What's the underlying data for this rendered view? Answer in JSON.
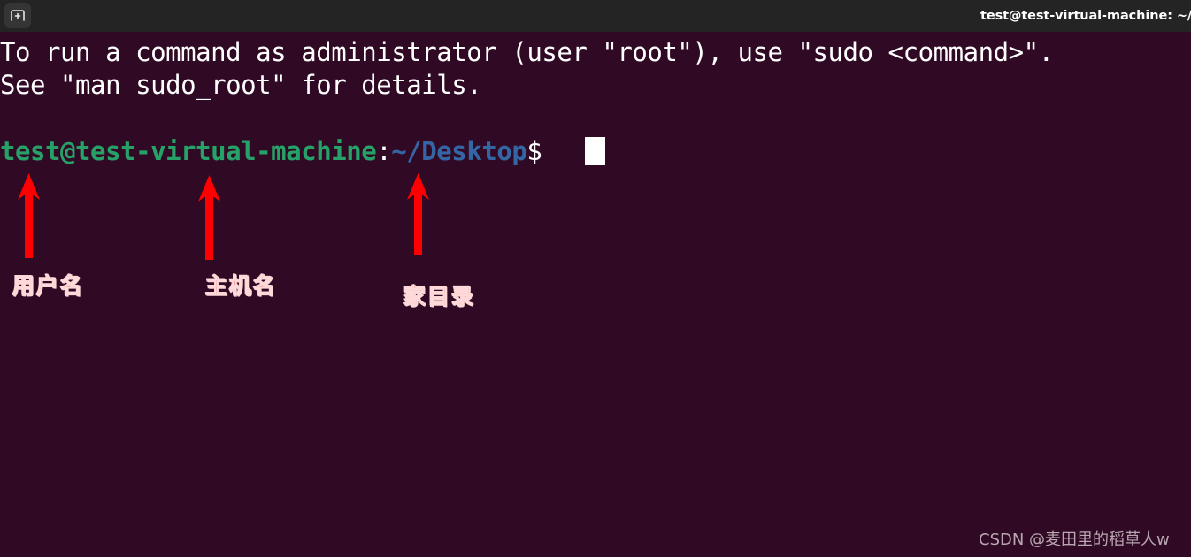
{
  "window": {
    "titlebar": {
      "title": "test@test-virtual-machine: ~/Desk",
      "new_tab_icon": "new-tab-icon",
      "background_color": "#242424",
      "title_color": "#ffffff"
    },
    "terminal": {
      "background_color": "#300a24",
      "foreground_color": "#ffffff",
      "lines": [
        "To run a command as administrator (user \"root\"), use \"sudo <command>\".",
        "See \"man sudo_root\" for details."
      ],
      "prompt": {
        "user_host": "test@test-virtual-machine",
        "separator": ":",
        "path": "~/Desktop",
        "sigil": "$",
        "user_host_color": "#26a269",
        "path_color": "#3465a4",
        "cursor": "block-cursor",
        "cursor_color": "#ffffff"
      }
    }
  },
  "annotations": {
    "arrow_color": "#ff0000",
    "label_color": "#ff0000",
    "items": [
      {
        "label": "用户名",
        "arrow_name": "annotation-arrow-username"
      },
      {
        "label": "主机名",
        "arrow_name": "annotation-arrow-hostname"
      },
      {
        "label": "家目录",
        "arrow_name": "annotation-arrow-home-directory"
      }
    ]
  },
  "watermark": {
    "text": "CSDN @麦田里的稻草人w",
    "color": "#b9a7b2"
  }
}
